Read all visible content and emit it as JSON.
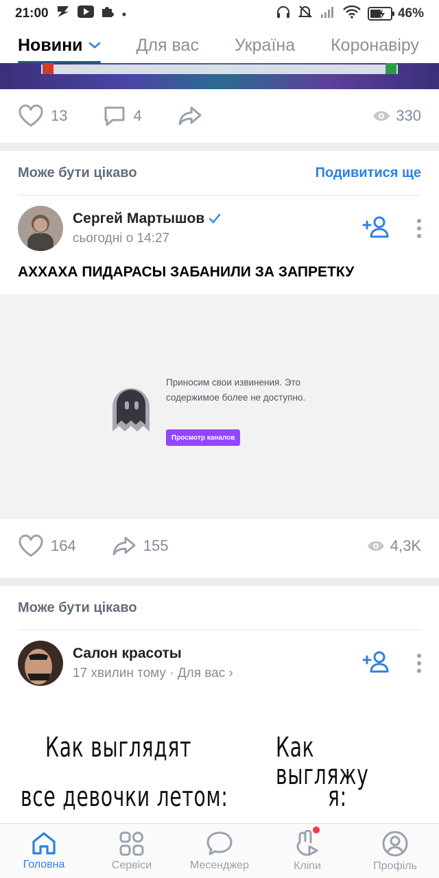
{
  "status_bar": {
    "time": "21:00",
    "battery": "46%"
  },
  "tabs": [
    {
      "label": "Новини"
    },
    {
      "label": "Для вас"
    },
    {
      "label": "Україна"
    },
    {
      "label": "Коронавіру"
    }
  ],
  "post1_actions": {
    "likes": "13",
    "comments": "4",
    "views": "330"
  },
  "recommend1": {
    "title": "Може бути цікаво",
    "link": "Подивитися ще"
  },
  "post2": {
    "author": "Сергей Мартышов",
    "meta": "сьогодні о 14:27",
    "text": "АХХАХА ПИДАРАСЫ ЗАБАНИЛИ ЗА ЗАПРЕТКУ",
    "media_error": "Приносим свои извинения. Это содержимое более не доступно.",
    "media_button": "Просмотр каналов",
    "likes": "164",
    "shares": "155",
    "views": "4,3K"
  },
  "recommend2": {
    "title": "Може бути цікаво"
  },
  "post3": {
    "author": "Салон красоты",
    "meta": "17 хвилин тому · Для вас ›",
    "meme_left_1": "Как выглядят",
    "meme_left_2": "все девочки летом:",
    "meme_right_1": "Как выгляжу",
    "meme_right_2": "я:"
  },
  "bottom_nav": [
    {
      "label": "Головна"
    },
    {
      "label": "Сервіси"
    },
    {
      "label": "Месенджер"
    },
    {
      "label": "Кліпи"
    },
    {
      "label": "Профіль"
    }
  ],
  "colors": {
    "accent": "#2d81e0",
    "twitch_purple": "#9147ff",
    "notification": "#ff3347"
  }
}
